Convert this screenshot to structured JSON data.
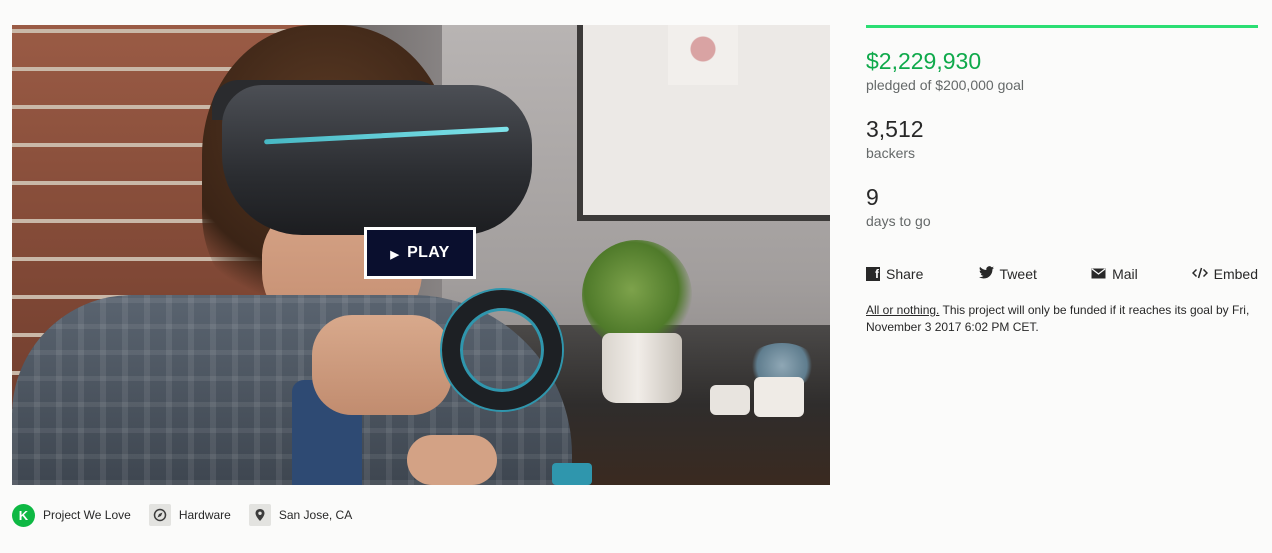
{
  "video": {
    "play_label": "PLAY"
  },
  "meta": {
    "badge_letter": "K",
    "project_we_love": "Project We Love",
    "category": "Hardware",
    "location": "San Jose, CA"
  },
  "stats": {
    "progress_fraction": 1.0,
    "pledged_amount": "$2,229,930",
    "pledged_goal": "pledged of $200,000 goal",
    "backers_count": "3,512",
    "backers_label": "backers",
    "days_count": "9",
    "days_label": "days to go"
  },
  "share": {
    "facebook_label": "Share",
    "twitter_label": "Tweet",
    "mail_label": "Mail",
    "embed_label": "Embed"
  },
  "funding_note": {
    "link_text": "All or nothing.",
    "text": " This project will only be funded if it reaches its goal by Fri, November 3 2017 6:02 PM CET."
  },
  "colors": {
    "accent_green": "#0fa94b",
    "progress_green": "#2bde73",
    "badge_green": "#0eb843",
    "play_bg": "#0a0f2e"
  }
}
